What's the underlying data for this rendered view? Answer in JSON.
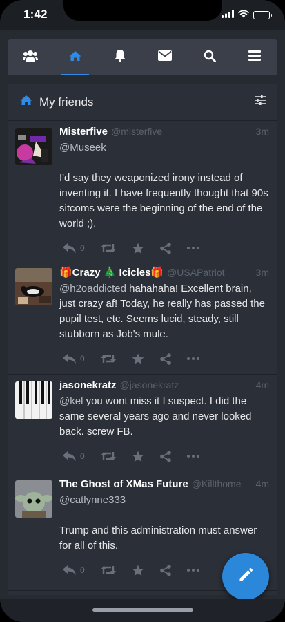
{
  "status_bar": {
    "time": "1:42"
  },
  "nav": {
    "items": [
      {
        "icon": "users-icon"
      },
      {
        "icon": "home-icon",
        "active": true
      },
      {
        "icon": "bell-icon"
      },
      {
        "icon": "envelope-icon"
      },
      {
        "icon": "search-icon"
      },
      {
        "icon": "menu-icon"
      }
    ],
    "accent": "#2f8be6"
  },
  "feed": {
    "title": "My friends",
    "posts": [
      {
        "name": "Misterfive",
        "handle": "@misterfive",
        "time": "3m",
        "mention": "@Museek",
        "text": "I'd say they weaponized irony instead of inventing it. I have frequently thought that 90s sitcoms were the beginning of the end of the world ;).",
        "reply_count": "0"
      },
      {
        "name": "🎁Crazy 🎄 Icicles🎁",
        "handle": "@USAPatriot",
        "time": "3m",
        "mention": "@h2oaddicted",
        "text": "hahahaha!   Excellent brain, just crazy af! Today, he really has passed the pupil test, etc. Seems lucid, steady, still stubborn as Job's mule.",
        "reply_count": "0"
      },
      {
        "name": "jasonekratz",
        "handle": "@jasonekratz",
        "time": "4m",
        "mention": "@kel",
        "text": "you wont miss it I suspect. I did the same several years ago and never looked back. screw FB.",
        "reply_count": "0"
      },
      {
        "name": "The Ghost of XMas Future",
        "handle": "@Killthome",
        "time": "4m",
        "mention": "@catlynne333",
        "text": "Trump and this administration must answer for all of this.",
        "reply_count": "0"
      }
    ]
  },
  "fab": {
    "icon": "pencil-icon",
    "color": "#2b87da"
  }
}
